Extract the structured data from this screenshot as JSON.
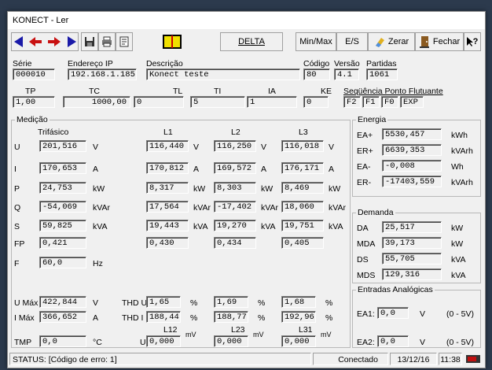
{
  "window": {
    "title": "KONECT - Ler"
  },
  "toolbar": {
    "delta": "DELTA",
    "minmax": "Min/Max",
    "es": "E/S",
    "zerar": "Zerar",
    "fechar": "Fechar",
    "help": "?"
  },
  "header": {
    "serie_label": "Série",
    "serie": "000010",
    "ip_label": "Endereço IP",
    "ip": "192.168.1.185",
    "desc_label": "Descrição",
    "desc": "Konect teste",
    "codigo_label": "Código",
    "codigo": "80",
    "versao_label": "Versão",
    "versao": "4.1",
    "partidas_label": "Partidas",
    "partidas": "1061",
    "tp_label": "TP",
    "tp": "1,00",
    "tc_label": "TC",
    "tc": "1000,00",
    "tl_label": "TL",
    "tl": "0",
    "ti_label": "TI",
    "ti": "5",
    "ia_label": "IA",
    "ia": "1",
    "ke_label": "KE",
    "ke": "0",
    "seq_label": "Seqüência Ponto Flutuante",
    "seq": [
      "F2",
      "F1",
      "F0",
      "EXP"
    ]
  },
  "medicao": {
    "title": "Medição",
    "col_tri": "Trifásico",
    "col_l1": "L1",
    "col_l2": "L2",
    "col_l3": "L3",
    "rows": [
      {
        "label": "U",
        "tri": "201,516",
        "tri_u": "V",
        "l1": "116,440",
        "l1_u": "V",
        "l2": "116,250",
        "l2_u": "V",
        "l3": "116,018",
        "l3_u": "V"
      },
      {
        "label": "I",
        "tri": "170,653",
        "tri_u": "A",
        "l1": "170,812",
        "l1_u": "A",
        "l2": "169,572",
        "l2_u": "A",
        "l3": "176,171",
        "l3_u": "A"
      },
      {
        "label": "P",
        "tri": "24,753",
        "tri_u": "kW",
        "l1": "8,317",
        "l1_u": "kW",
        "l2": "8,303",
        "l2_u": "kW",
        "l3": "8,469",
        "l3_u": "kW"
      },
      {
        "label": "Q",
        "tri": "-54,069",
        "tri_u": "kVAr",
        "l1": "17,564",
        "l1_u": "kVAr",
        "l2": "-17,402",
        "l2_u": "kVAr",
        "l3": "18,060",
        "l3_u": "kVAr"
      },
      {
        "label": "S",
        "tri": "59,825",
        "tri_u": "kVA",
        "l1": "19,443",
        "l1_u": "kVA",
        "l2": "19,270",
        "l2_u": "kVA",
        "l3": "19,751",
        "l3_u": "kVA"
      },
      {
        "label": "FP",
        "tri": "0,421",
        "tri_u": "",
        "l1": "0,430",
        "l1_u": "",
        "l2": "0,434",
        "l2_u": "",
        "l3": "0,405",
        "l3_u": ""
      },
      {
        "label": "F",
        "tri": "60,0",
        "tri_u": "Hz",
        "l1": "",
        "l1_u": "",
        "l2": "",
        "l2_u": "",
        "l3": "",
        "l3_u": ""
      }
    ],
    "umax_label": "U Máx",
    "umax": "422,844",
    "umax_u": "V",
    "imax_label": "I Máx",
    "imax": "366,652",
    "imax_u": "A",
    "thdu_label": "THD U",
    "thdu": [
      "1,65",
      "1,69",
      "1,68"
    ],
    "thdi_label": "THD I",
    "thdi": [
      "188,44",
      "188,77",
      "192,96"
    ],
    "pct": "%",
    "l12": "L12",
    "l23": "L23",
    "l31": "L31",
    "tmp_label": "TMP",
    "tmp": "0,0",
    "tmp_u": "°C",
    "u_label": "U",
    "u": [
      "0,000",
      "0,000",
      "0,000"
    ],
    "mv": "mV"
  },
  "energia": {
    "title": "Energia",
    "rows": [
      {
        "label": "EA+",
        "value": "5530,457",
        "unit": "kWh"
      },
      {
        "label": "ER+",
        "value": "6639,353",
        "unit": "kVArh"
      },
      {
        "label": "EA-",
        "value": "-0,008",
        "unit": "Wh"
      },
      {
        "label": "ER-",
        "value": "-17403,559",
        "unit": "kVArh"
      }
    ]
  },
  "demanda": {
    "title": "Demanda",
    "rows": [
      {
        "label": "DA",
        "value": "25,517",
        "unit": "kW"
      },
      {
        "label": "MDA",
        "value": "39,173",
        "unit": "kW"
      },
      {
        "label": "DS",
        "value": "55,705",
        "unit": "kVA"
      },
      {
        "label": "MDS",
        "value": "129,316",
        "unit": "kVA"
      }
    ]
  },
  "entradas": {
    "title": "Entradas Analógicas",
    "rows": [
      {
        "label": "EA1:",
        "value": "0,0",
        "unit": "V",
        "range": "(0 - 5V)"
      },
      {
        "label": "EA2:",
        "value": "0,0",
        "unit": "V",
        "range": "(0 - 5V)"
      }
    ]
  },
  "status": {
    "text": "STATUS: [Código de erro: 1]",
    "conn": "Conectado",
    "date": "13/12/16",
    "time": "11:38"
  }
}
